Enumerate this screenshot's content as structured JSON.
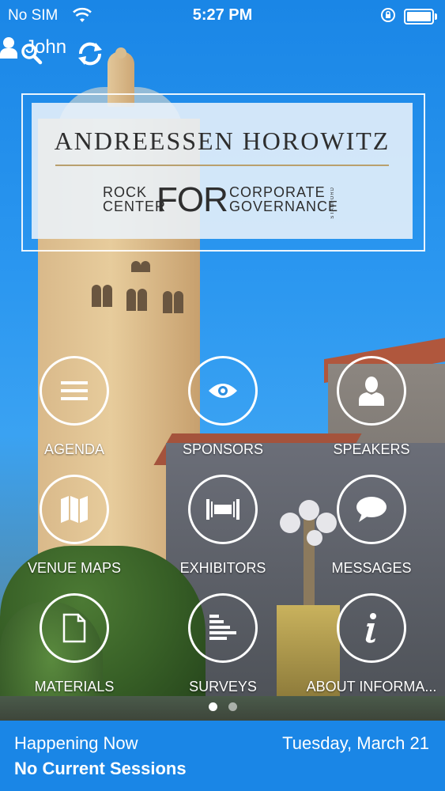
{
  "status_bar": {
    "carrier": "No SIM",
    "time": "5:27 PM"
  },
  "header": {
    "user_name": "John"
  },
  "banner": {
    "firm": "ANDREESSEN HOROWITZ",
    "rock_line1": "ROCK",
    "rock_line2": "CENTER",
    "for_text": "FOR",
    "corp_line1": "CORPORATE",
    "corp_line2": "GOVERNANCE",
    "stanford": "STANFORD"
  },
  "menu": [
    {
      "label": "AGENDA",
      "icon": "list-icon"
    },
    {
      "label": "SPONSORS",
      "icon": "eye-icon"
    },
    {
      "label": "SPEAKERS",
      "icon": "person-icon"
    },
    {
      "label": "VENUE MAPS",
      "icon": "map-icon"
    },
    {
      "label": "EXHIBITORS",
      "icon": "exhibit-icon"
    },
    {
      "label": "MESSAGES",
      "icon": "chat-bubble-icon"
    },
    {
      "label": "MATERIALS",
      "icon": "document-icon"
    },
    {
      "label": "SURVEYS",
      "icon": "bars-icon"
    },
    {
      "label": "ABOUT INFORMA...",
      "icon": "info-icon"
    }
  ],
  "pager": {
    "pages": 2,
    "active": 1
  },
  "footer": {
    "happening_label": "Happening Now",
    "date": "Tuesday, March 21",
    "sessions": "No Current Sessions"
  },
  "colors": {
    "accent": "#1a86e6",
    "text": "#ffffff"
  }
}
